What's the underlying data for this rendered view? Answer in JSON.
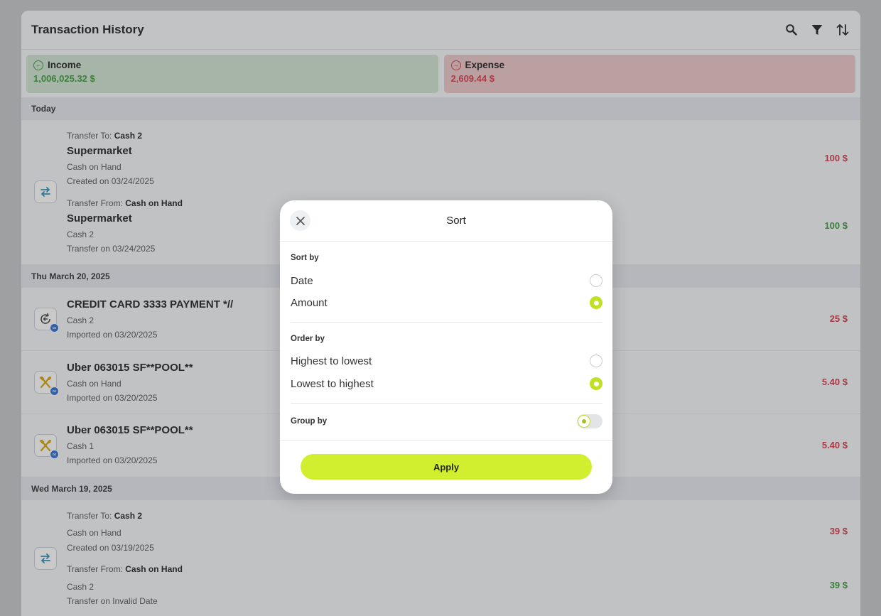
{
  "header": {
    "title": "Transaction History"
  },
  "summary": {
    "income": {
      "label": "Income",
      "amount": "1,006,025.32 $",
      "color": "#3a9a3a"
    },
    "expense": {
      "label": "Expense",
      "amount": "2,609.44 $",
      "color": "#d23b4a"
    }
  },
  "groups": [
    {
      "date": "Today",
      "transactions": [
        {
          "icon": "transfer-icon",
          "to_label": "Transfer To:",
          "to_account": "Cash 2",
          "name1": "Supermarket",
          "account1": "Cash on Hand",
          "created1": "Created on 03/24/2025",
          "amount1": "100 $",
          "from_label": "Transfer From:",
          "from_account": "Cash on Hand",
          "name2": "Supermarket",
          "account2": "Cash 2",
          "created2": "Transfer on 03/24/2025",
          "amount2": "100 $"
        }
      ]
    },
    {
      "date": "Thu March 20, 2025",
      "transactions": [
        {
          "icon": "refund-icon",
          "name": "CREDIT CARD 3333 PAYMENT *//",
          "account": "Cash 2",
          "created": "Imported on 03/20/2025",
          "amount": "25 $"
        },
        {
          "icon": "restaurant-icon",
          "name": "Uber 063015 SF**POOL**",
          "account": "Cash on Hand",
          "created": "Imported on 03/20/2025",
          "amount": "5.40 $"
        },
        {
          "icon": "restaurant-icon",
          "name": "Uber 063015 SF**POOL**",
          "account": "Cash 1",
          "created": "Imported on 03/20/2025",
          "amount": "5.40 $"
        }
      ]
    },
    {
      "date": "Wed March 19, 2025",
      "transactions": [
        {
          "icon": "transfer-icon",
          "to_label": "Transfer To:",
          "to_account": "Cash 2",
          "account1": "Cash on Hand",
          "created1": "Created on 03/19/2025",
          "amount1": "39 $",
          "from_label": "Transfer From:",
          "from_account": "Cash on Hand",
          "account2": "Cash 2",
          "created2": "Transfer on Invalid Date",
          "amount2": "39 $"
        }
      ]
    }
  ],
  "modal": {
    "title": "Sort",
    "sort_by": {
      "label": "Sort by",
      "options": [
        {
          "label": "Date",
          "selected": false
        },
        {
          "label": "Amount",
          "selected": true
        }
      ]
    },
    "order_by": {
      "label": "Order by",
      "options": [
        {
          "label": "Highest to lowest",
          "selected": false
        },
        {
          "label": "Lowest to highest",
          "selected": true
        }
      ]
    },
    "group_by": {
      "label": "Group by",
      "enabled": false
    },
    "apply_label": "Apply",
    "accent": "#d2ef2f"
  }
}
